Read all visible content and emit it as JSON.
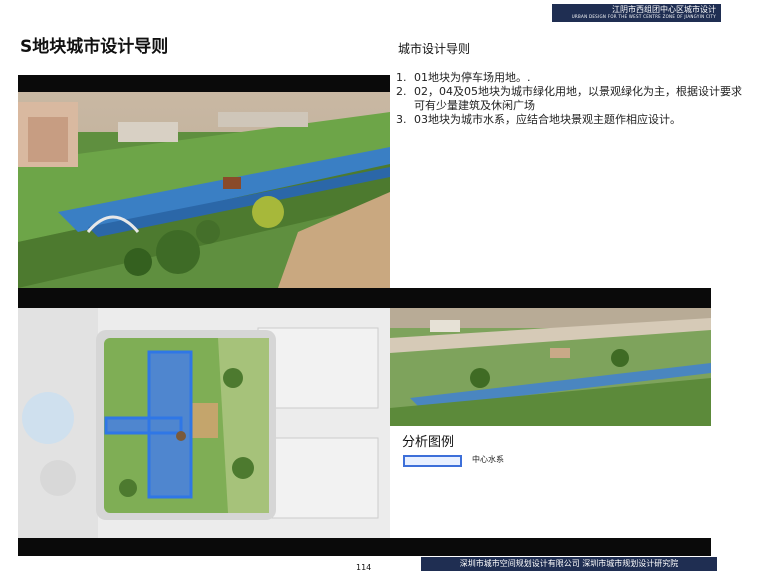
{
  "header": {
    "title": "江阴市西组团中心区城市设计",
    "subtitle": "URBAN DESIGN FOR THE WEST CENTRE ZONE OF JIANGYIN CITY"
  },
  "page_title": "S地块城市设计导则",
  "guidelines": {
    "heading": "城市设计导则",
    "items": [
      {
        "num": "1.",
        "text": "01地块为停车场用地。."
      },
      {
        "num": "2.",
        "text": "02，04及05地块为城市绿化用地，以景观绿化为主，根据设计要求可有少量建筑及休闲广场"
      },
      {
        "num": "3.",
        "text": "03地块为城市水系，应结合地块景观主题作相应设计。"
      }
    ]
  },
  "legend": {
    "title": "分析图例",
    "item_label": "中心水系",
    "item_color": "#3d6fd9"
  },
  "footer": {
    "page_number": "114",
    "org_text": "深圳市城市空间规划设计有限公司 深圳市城市规划设计研究院"
  }
}
